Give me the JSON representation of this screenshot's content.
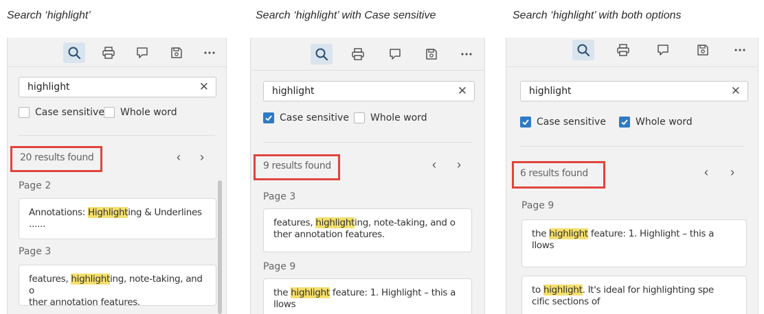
{
  "captions": {
    "p1": "Search ‘highlight’",
    "p2": "Search ‘highlight’ with Case sensitive",
    "p3": "Search ‘highlight’ with both options"
  },
  "colors": {
    "panel_bg": "#f2f2f2",
    "active_tool_bg": "#d9e4ee",
    "checkbox_checked": "#2f7ac4",
    "highlight": "#f5df6b",
    "callout_box": "#e0443c"
  },
  "toolbar_icons": [
    "search-icon",
    "print-icon",
    "comment-icon",
    "save-icon",
    "more-icon"
  ],
  "panels": [
    {
      "search_value": "highlight",
      "case_sensitive": {
        "label": "Case sensitive",
        "checked": false
      },
      "whole_word": {
        "label": "Whole word",
        "checked": false
      },
      "results_text": "20 results found",
      "groups": [
        {
          "page": "Page 2",
          "snippet": {
            "before": "Annotations: ",
            "match": "Highlight",
            "after": "ing & Underlines",
            "line2": "......"
          }
        },
        {
          "page": "Page 3",
          "snippet": {
            "before": "features, ",
            "match": "highlight",
            "after": "ing, note-taking, and o",
            "line2": "ther annotation features."
          }
        }
      ]
    },
    {
      "search_value": "highlight",
      "case_sensitive": {
        "label": "Case sensitive",
        "checked": true
      },
      "whole_word": {
        "label": "Whole word",
        "checked": false
      },
      "results_text": "9 results found",
      "groups": [
        {
          "page": "Page 3",
          "snippet": {
            "before": "features, ",
            "match": "highlight",
            "after": "ing, note-taking, and o",
            "line2": "ther annotation features."
          }
        },
        {
          "page": "Page 9",
          "snippet": {
            "before": "the ",
            "match": "highlight",
            "after": " feature: 1. Highlight – this a",
            "line2": "llows"
          }
        }
      ]
    },
    {
      "search_value": "highlight",
      "case_sensitive": {
        "label": "Case sensitive",
        "checked": true
      },
      "whole_word": {
        "label": "Whole word",
        "checked": true
      },
      "results_text": "6 results found",
      "groups": [
        {
          "page": "Page 9",
          "snippet": {
            "before": "the ",
            "match": "highlight",
            "after": " feature: 1. Highlight – this a",
            "line2": "llows"
          }
        },
        {
          "page": "",
          "snippet": {
            "before": "to ",
            "match": "highlight",
            "after": ". It's ideal for highlighting spe",
            "line2": "cific sections of"
          }
        }
      ]
    }
  ]
}
